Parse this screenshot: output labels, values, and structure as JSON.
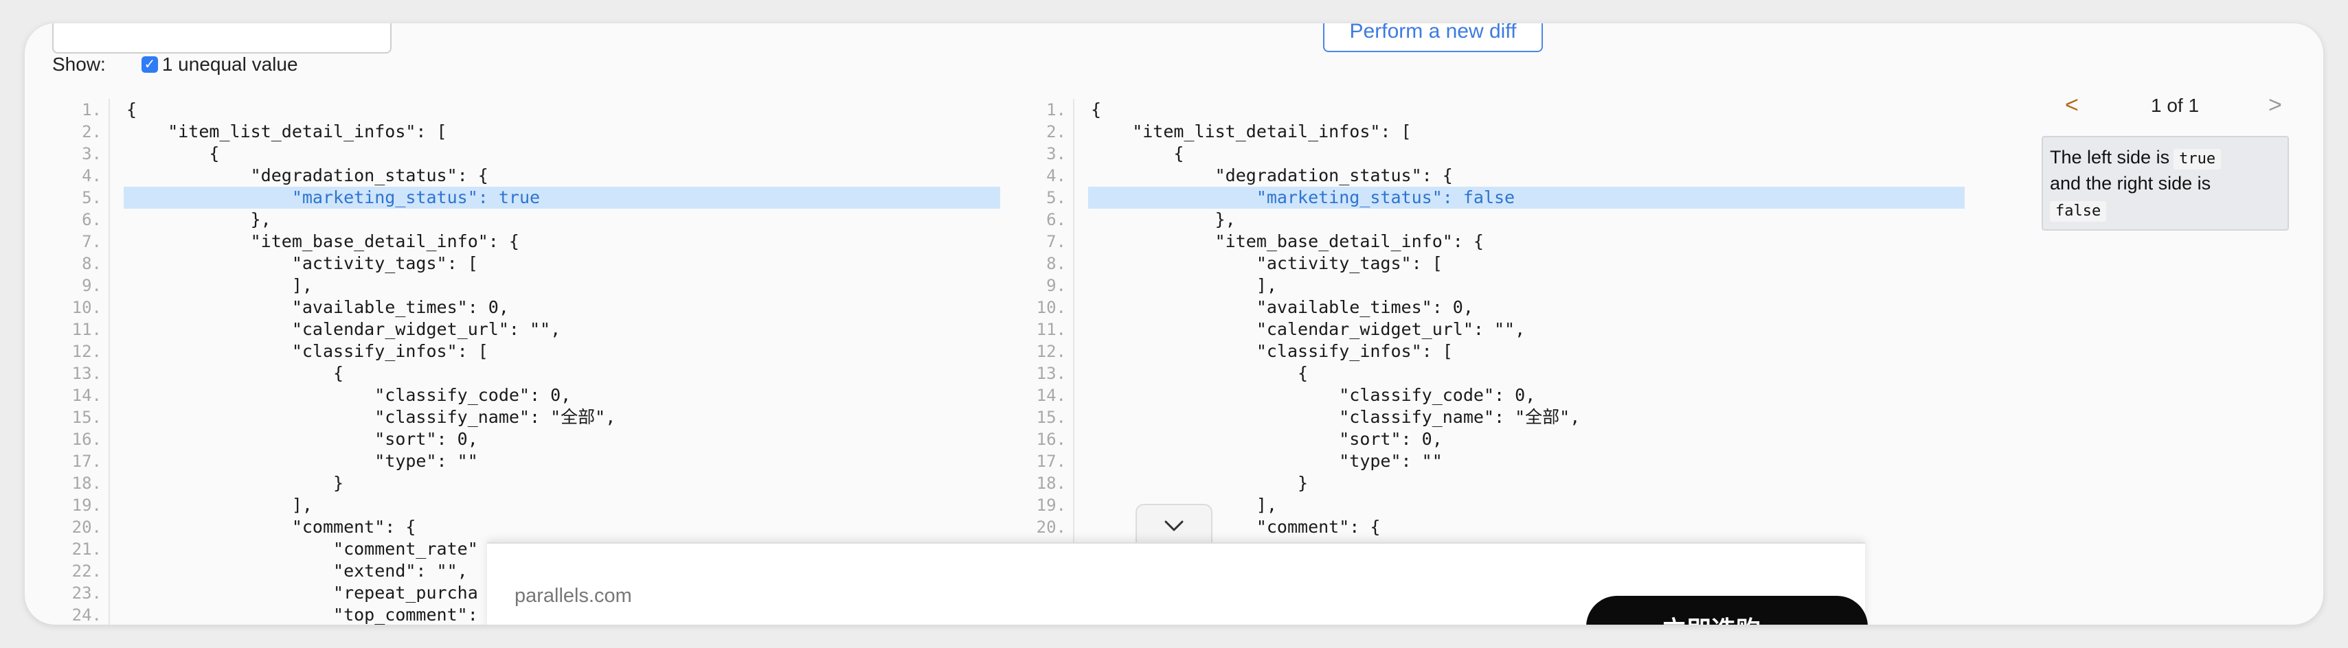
{
  "toolbar": {
    "top_input_value": "",
    "perform_button_label": "Perform a new diff"
  },
  "filter": {
    "show_label": "Show:",
    "checkbox_checked": true,
    "checkbox_label": "1 unequal value"
  },
  "left_pane": {
    "lines": [
      {
        "n": "1.",
        "text": "{"
      },
      {
        "n": "2.",
        "text": "    \"item_list_detail_infos\": ["
      },
      {
        "n": "3.",
        "text": "        {"
      },
      {
        "n": "4.",
        "text": "            \"degradation_status\": {"
      },
      {
        "n": "5.",
        "text": "                \"marketing_status\": true",
        "highlight": true
      },
      {
        "n": "6.",
        "text": "            },"
      },
      {
        "n": "7.",
        "text": "            \"item_base_detail_info\": {"
      },
      {
        "n": "8.",
        "text": "                \"activity_tags\": ["
      },
      {
        "n": "9.",
        "text": "                ],"
      },
      {
        "n": "10.",
        "text": "                \"available_times\": 0,"
      },
      {
        "n": "11.",
        "text": "                \"calendar_widget_url\": \"\","
      },
      {
        "n": "12.",
        "text": "                \"classify_infos\": ["
      },
      {
        "n": "13.",
        "text": "                    {"
      },
      {
        "n": "14.",
        "text": "                        \"classify_code\": 0,"
      },
      {
        "n": "15.",
        "text": "                        \"classify_name\": \"全部\","
      },
      {
        "n": "16.",
        "text": "                        \"sort\": 0,"
      },
      {
        "n": "17.",
        "text": "                        \"type\": \"\""
      },
      {
        "n": "18.",
        "text": "                    }"
      },
      {
        "n": "19.",
        "text": "                ],"
      },
      {
        "n": "20.",
        "text": "                \"comment\": {"
      },
      {
        "n": "21.",
        "text": "                    \"comment_rate\""
      },
      {
        "n": "22.",
        "text": "                    \"extend\": \"\","
      },
      {
        "n": "23.",
        "text": "                    \"repeat_purcha"
      },
      {
        "n": "24.",
        "text": "                    \"top_comment\":"
      }
    ]
  },
  "right_pane": {
    "lines": [
      {
        "n": "1.",
        "text": "{"
      },
      {
        "n": "2.",
        "text": "    \"item_list_detail_infos\": ["
      },
      {
        "n": "3.",
        "text": "        {"
      },
      {
        "n": "4.",
        "text": "            \"degradation_status\": {"
      },
      {
        "n": "5.",
        "text": "                \"marketing_status\": false",
        "highlight": true
      },
      {
        "n": "6.",
        "text": "            },"
      },
      {
        "n": "7.",
        "text": "            \"item_base_detail_info\": {"
      },
      {
        "n": "8.",
        "text": "                \"activity_tags\": ["
      },
      {
        "n": "9.",
        "text": "                ],"
      },
      {
        "n": "10.",
        "text": "                \"available_times\": 0,"
      },
      {
        "n": "11.",
        "text": "                \"calendar_widget_url\": \"\","
      },
      {
        "n": "12.",
        "text": "                \"classify_infos\": ["
      },
      {
        "n": "13.",
        "text": "                    {"
      },
      {
        "n": "14.",
        "text": "                        \"classify_code\": 0,"
      },
      {
        "n": "15.",
        "text": "                        \"classify_name\": \"全部\","
      },
      {
        "n": "16.",
        "text": "                        \"sort\": 0,"
      },
      {
        "n": "17.",
        "text": "                        \"type\": \"\""
      },
      {
        "n": "18.",
        "text": "                    }"
      },
      {
        "n": "19.",
        "text": "                ],"
      },
      {
        "n": "20.",
        "text": "                \"comment\": {"
      }
    ]
  },
  "navigator": {
    "prev_icon": "chevron-left-icon",
    "prev_glyph": "<",
    "count": "1 of 1",
    "next_icon": "chevron-right-icon",
    "next_glyph": ">"
  },
  "info": {
    "left_text": "The left side is",
    "left_value": "true",
    "right_text": "and the right side is",
    "right_value": "false"
  },
  "bottom_bar": {
    "domain": "parallels.com",
    "cta_label": "立即选购 →",
    "collapse_icon": "chevron-down-icon"
  },
  "colors": {
    "highlight_bg": "#cfe5fb",
    "highlight_text": "#2d74d0",
    "accent": "#2f7cf6"
  }
}
